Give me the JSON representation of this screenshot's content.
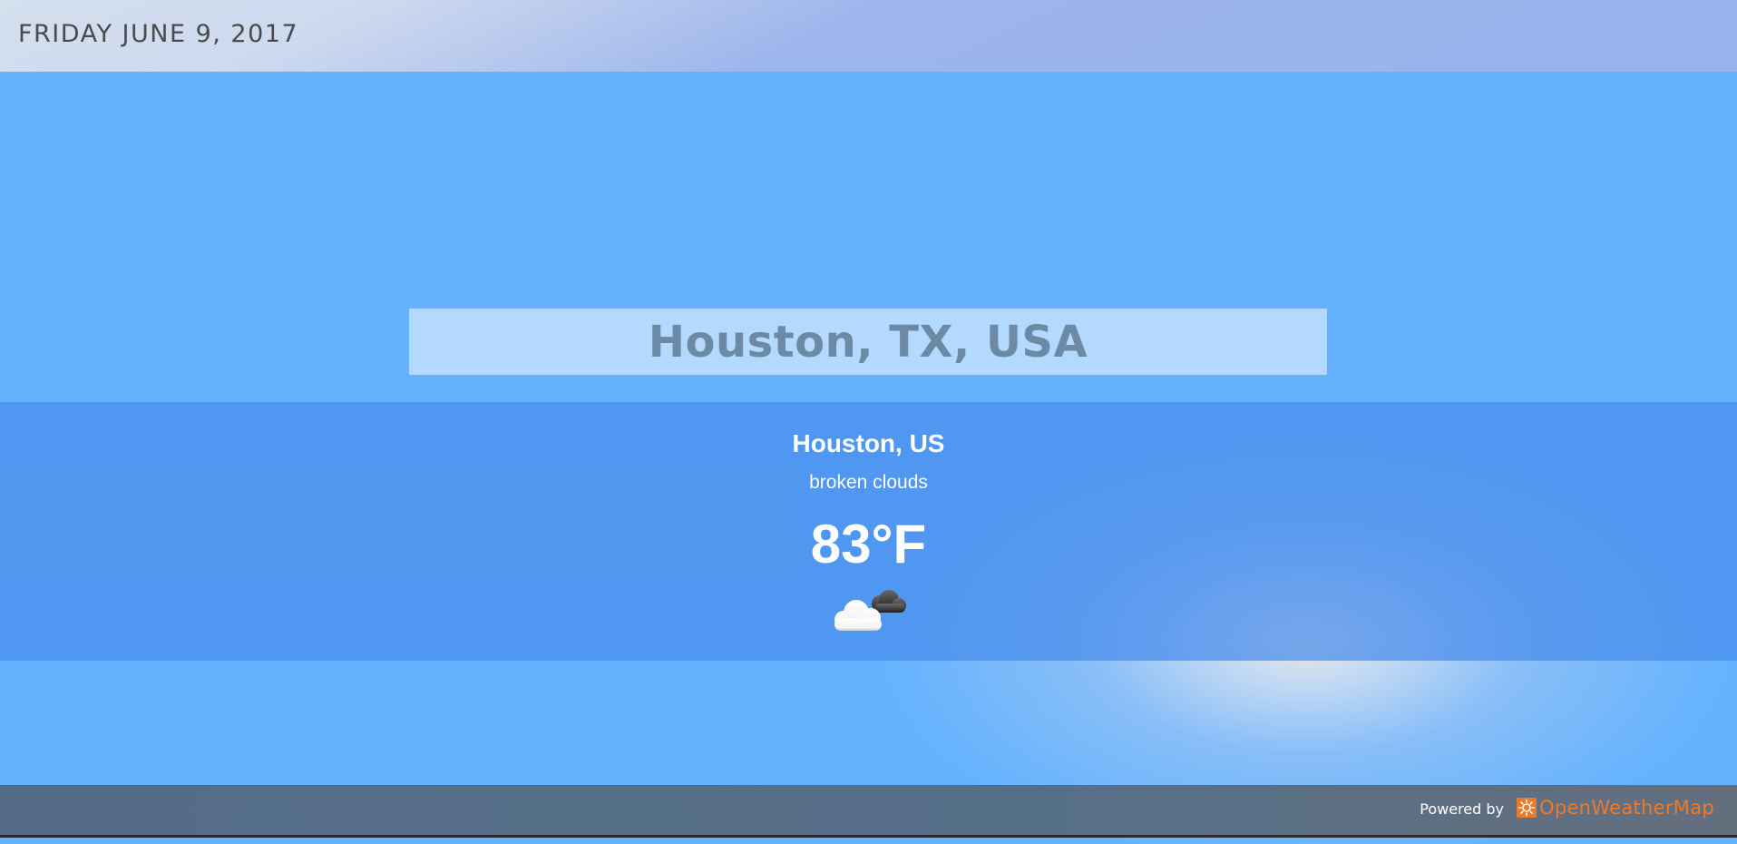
{
  "header": {
    "date": "FRIDAY JUNE 9, 2017"
  },
  "search": {
    "location_value": "Houston, TX, USA"
  },
  "weather": {
    "city": "Houston, US",
    "description": "broken clouds",
    "temperature": "83°F",
    "icon": "broken-clouds-icon"
  },
  "footer": {
    "powered_by": "Powered by",
    "provider": "OpenWeatherMap"
  },
  "colors": {
    "background": "#64b2fe",
    "band": "#4f97ed",
    "footer": "#566f89",
    "provider_accent": "#eb7b2c",
    "date_text": "#4a4a4a"
  }
}
